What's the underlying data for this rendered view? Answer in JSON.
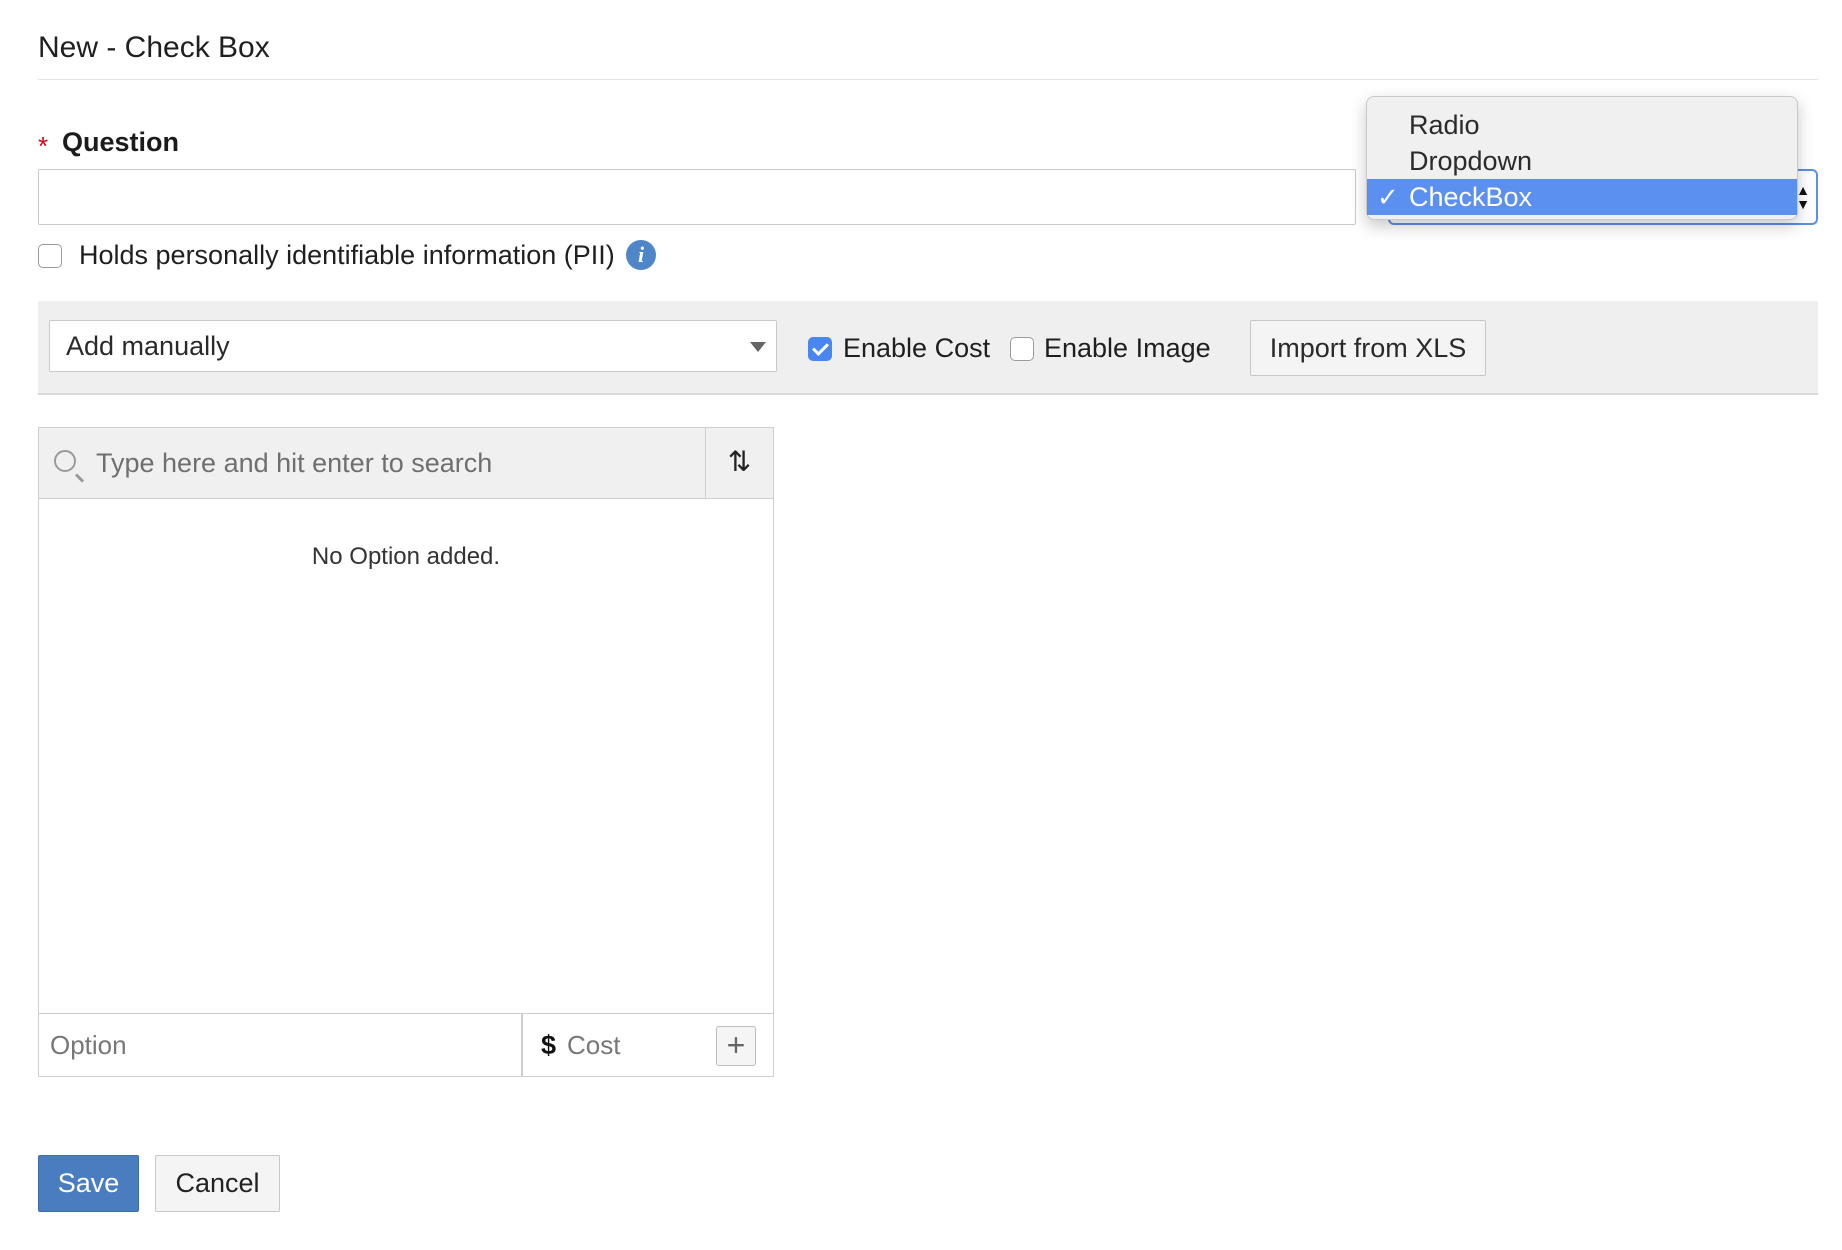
{
  "header": {
    "title": "New - Check Box"
  },
  "question": {
    "required_mark": "*",
    "label": "Question",
    "value": "",
    "placeholder": ""
  },
  "type_select": {
    "selected": "CheckBox",
    "check_glyph": "✓",
    "options": [
      "Radio",
      "Dropdown",
      "CheckBox"
    ]
  },
  "pii": {
    "label": "Holds personally identifiable information (PII)",
    "checked": false,
    "info_glyph": "i"
  },
  "toolbar": {
    "source_select_value": "Add manually",
    "enable_cost_label": "Enable Cost",
    "enable_cost_checked": true,
    "enable_image_label": "Enable Image",
    "enable_image_checked": false,
    "import_label": "Import from XLS"
  },
  "options_panel": {
    "search_placeholder": "Type here and hit enter to search",
    "sort_glyph": "⇅",
    "empty_message": "No Option added.",
    "option_placeholder": "Option",
    "currency_symbol": "$",
    "cost_placeholder": "Cost",
    "add_glyph": "+"
  },
  "actions": {
    "save_label": "Save",
    "cancel_label": "Cancel"
  },
  "colors": {
    "primary_button": "#4a7cc0",
    "selected_menu_item": "#5b8ff0",
    "checkbox_checked": "#4a86f0",
    "required_star": "#d0021b",
    "info_icon": "#4f86c9"
  },
  "icons": {
    "search": "search-icon",
    "sort": "sort-icon",
    "info": "info-icon",
    "add": "plus-icon",
    "caret": "caret-down-icon",
    "check": "checkmark-icon"
  }
}
